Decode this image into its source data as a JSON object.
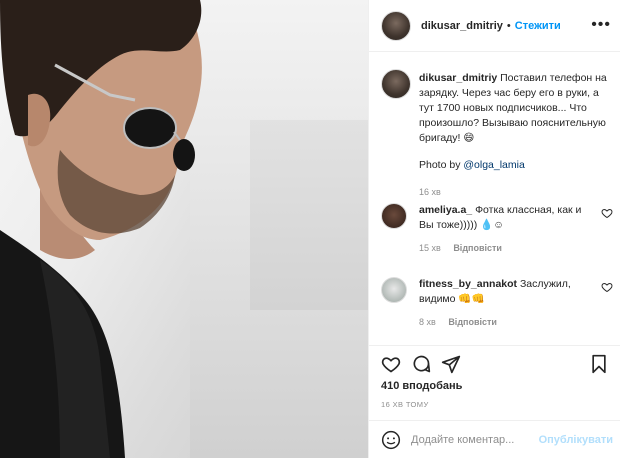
{
  "header": {
    "username": "dikusar_dmitriy",
    "separator": "•",
    "follow_label": "Стежити",
    "more_label": "•••"
  },
  "caption": {
    "username": "dikusar_dmitriy",
    "text": "Поставил телефон на зарядку. Через час беру его в руки, а тут 1700 новых подписчиков... Что произошло? Вызываю пояснительную бригаду! 😄",
    "photo_by_prefix": "Photo by ",
    "photo_by_mention": "@olga_lamia",
    "time": "16 хв"
  },
  "comments": [
    {
      "username": "ameliya.a_",
      "text": "Фотка классная, как и Вы тоже))))) 💧☺",
      "time": "15 хв",
      "reply_label": "Відповісти"
    },
    {
      "username": "fitness_by_annakot",
      "text": "Заслужил, видимо 👊👊",
      "time": "8 хв",
      "reply_label": "Відповісти"
    }
  ],
  "actions": {
    "likes": "410 вподобань",
    "posted": "16 ХВ ТОМУ"
  },
  "comment_box": {
    "placeholder": "Додайте коментар...",
    "publish_label": "Опублікувати"
  },
  "colors": {
    "accent": "#0095f6",
    "publish_disabled": "#b2dffc",
    "muted": "#8e8e8e",
    "text": "#262626"
  }
}
